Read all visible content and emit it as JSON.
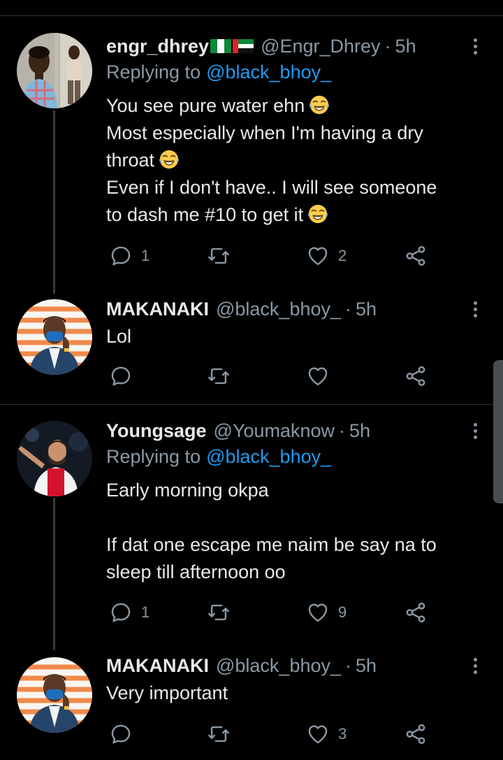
{
  "tweets": [
    {
      "name": "engr_dhrey",
      "handle": "@Engr_Dhrey",
      "time": "5h",
      "replying_label": "Replying to",
      "replying_handle": "@black_bhoy_",
      "lines": [
        "You see pure water ehn",
        "Most especially when I'm having a dry",
        "throat",
        "Even if I don't have.. I will see someone",
        "to dash me #10 to get it"
      ],
      "emoji": "face-with-tears-of-joy",
      "replies": "1",
      "retweets": "",
      "likes": "2"
    },
    {
      "name": "MAKANAKI",
      "handle": "@black_bhoy_",
      "time": "5h",
      "lines": [
        "Lol"
      ],
      "replies": "",
      "retweets": "",
      "likes": ""
    },
    {
      "name": "Youngsage",
      "handle": "@Youmaknow",
      "time": "5h",
      "replying_label": "Replying to",
      "replying_handle": "@black_bhoy_",
      "lines": [
        "Early morning okpa",
        "",
        "If dat one escape me naim be say na to",
        "sleep till afternoon oo"
      ],
      "replies": "1",
      "retweets": "",
      "likes": "9"
    },
    {
      "name": "MAKANAKI",
      "handle": "@black_bhoy_",
      "time": "5h",
      "lines": [
        "Very important"
      ],
      "replies": "",
      "retweets": "",
      "likes": "3"
    }
  ],
  "separator": "·",
  "colors": {
    "background": "#000000",
    "text": "#e7e9ea",
    "muted": "#8b98a5",
    "link": "#1d9bf0",
    "divider": "#2f3336"
  },
  "icons": [
    "reply-icon",
    "retweet-icon",
    "like-icon",
    "share-icon",
    "more-icon"
  ]
}
